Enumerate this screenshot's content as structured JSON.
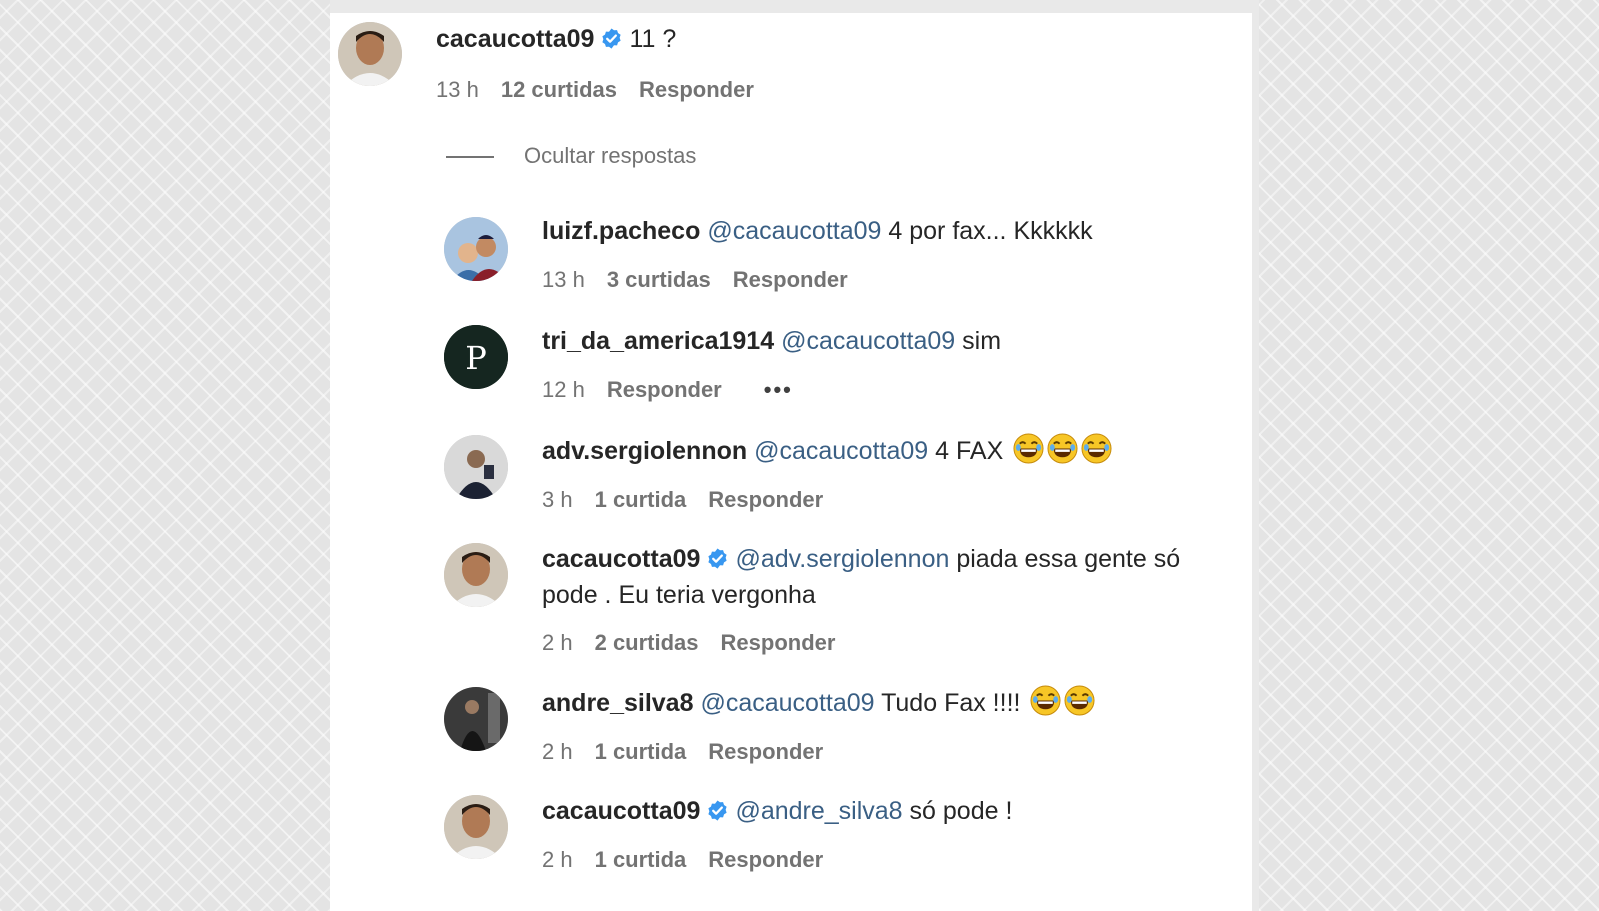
{
  "main_comment": {
    "username": "cacaucotta09",
    "verified": true,
    "text": "11 ?",
    "time": "13 h",
    "likes": "12 curtidas",
    "reply_label": "Responder"
  },
  "hide_replies_label": "Ocultar respostas",
  "replies": [
    {
      "username": "luizf.pacheco",
      "verified": false,
      "mention": "@cacaucotta09",
      "text": "4 por fax... Kkkkkk",
      "time": "13 h",
      "likes": "3 curtidas",
      "reply_label": "Responder"
    },
    {
      "username": "tri_da_america1914",
      "verified": false,
      "mention": "@cacaucotta09",
      "text": "sim",
      "time": "12 h",
      "likes": "",
      "reply_label": "Responder",
      "more": "•••"
    },
    {
      "username": "adv.sergiolennon",
      "verified": false,
      "mention": "@cacaucotta09",
      "text": "4 FAX",
      "emoji_count": 3,
      "time": "3 h",
      "likes": "1 curtida",
      "reply_label": "Responder"
    },
    {
      "username": "cacaucotta09",
      "verified": true,
      "mention": "@adv.sergiolennon",
      "text": "piada essa gente só pode . Eu teria vergonha",
      "time": "2 h",
      "likes": "2 curtidas",
      "reply_label": "Responder"
    },
    {
      "username": "andre_silva8",
      "verified": false,
      "mention": "@cacaucotta09",
      "text": "Tudo Fax !!!!",
      "emoji_count": 2,
      "time": "2 h",
      "likes": "1 curtida",
      "reply_label": "Responder"
    },
    {
      "username": "cacaucotta09",
      "verified": true,
      "mention": "@andre_silva8",
      "text": "só pode !",
      "time": "2 h",
      "likes": "1 curtida",
      "reply_label": "Responder"
    }
  ],
  "colors": {
    "verified_badge": "#3897f0",
    "mention": "#3a5f84",
    "meta_text": "#737373"
  }
}
